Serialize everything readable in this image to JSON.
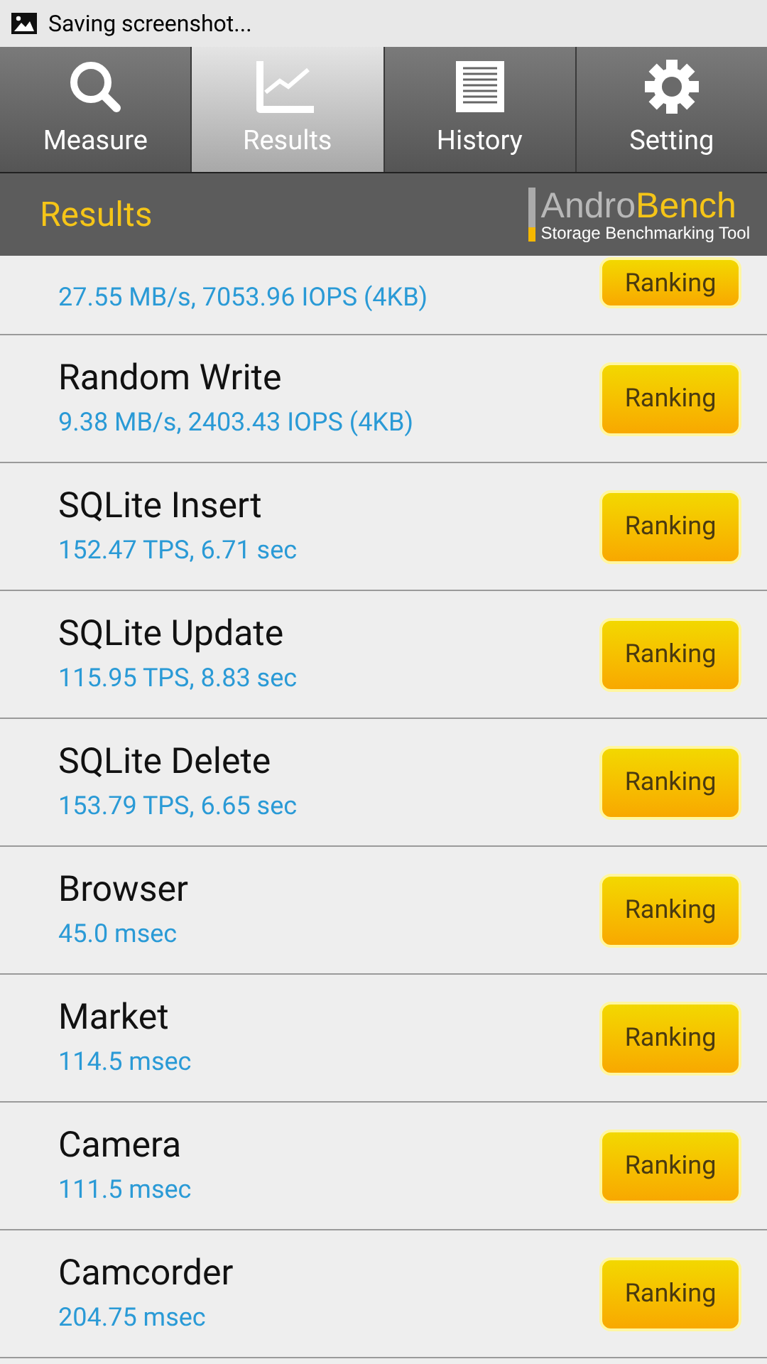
{
  "status_bar": {
    "text": "Saving screenshot..."
  },
  "tabs": [
    {
      "label": "Measure",
      "kind": "search",
      "selected": false
    },
    {
      "label": "Results",
      "kind": "chart",
      "selected": true
    },
    {
      "label": "History",
      "kind": "list",
      "selected": false
    },
    {
      "label": "Setting",
      "kind": "gear",
      "selected": false
    }
  ],
  "header": {
    "title": "Results",
    "logo_part_1": "Andro",
    "logo_part_2": "Bench",
    "logo_subtitle": "Storage Benchmarking Tool"
  },
  "results": [
    {
      "value": "27.55 MB/s, 7053.96 IOPS (4KB)",
      "button": "Ranking"
    },
    {
      "name": "Random Write",
      "value": "9.38 MB/s, 2403.43 IOPS (4KB)",
      "button": "Ranking"
    },
    {
      "name": "SQLite Insert",
      "value": "152.47 TPS, 6.71 sec",
      "button": "Ranking"
    },
    {
      "name": "SQLite Update",
      "value": "115.95 TPS, 8.83 sec",
      "button": "Ranking"
    },
    {
      "name": "SQLite Delete",
      "value": "153.79 TPS, 6.65 sec",
      "button": "Ranking"
    },
    {
      "name": "Browser",
      "value": "45.0 msec",
      "button": "Ranking"
    },
    {
      "name": "Market",
      "value": "114.5 msec",
      "button": "Ranking"
    },
    {
      "name": "Camera",
      "value": "111.5 msec",
      "button": "Ranking"
    },
    {
      "name": "Camcorder",
      "value": "204.75 msec",
      "button": "Ranking"
    }
  ]
}
